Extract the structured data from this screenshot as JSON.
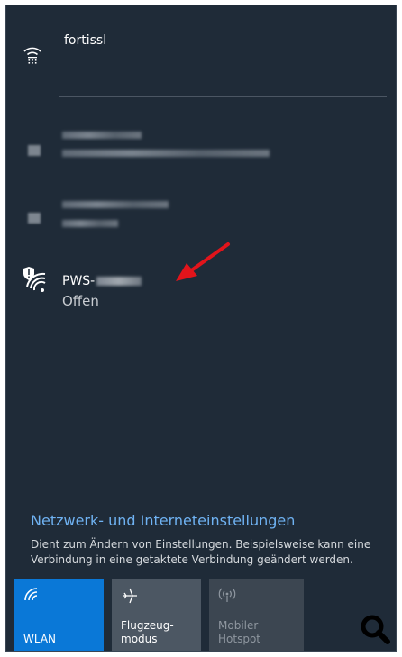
{
  "networks": {
    "connected": {
      "name": "fortissl"
    },
    "open": {
      "name": "PWS-",
      "status": "Offen"
    }
  },
  "settings": {
    "link": "Netzwerk- und Interneteinstellungen",
    "desc": "Dient zum Ändern von Einstellungen. Beispielsweise kann eine Verbindung in eine getaktete Verbindung geändert werden."
  },
  "tiles": [
    {
      "label": "WLAN",
      "icon": "wifi-icon",
      "active": true
    },
    {
      "label": "Flugzeug-\nmodus",
      "icon": "airplane-icon",
      "active": false
    },
    {
      "label": "Mobiler\nHotspot",
      "icon": "hotspot-icon",
      "active": false
    }
  ],
  "colors": {
    "panel": "#1f2b38",
    "accent": "#0a78d7",
    "link": "#6fb2f2",
    "arrow": "#e1141b"
  }
}
